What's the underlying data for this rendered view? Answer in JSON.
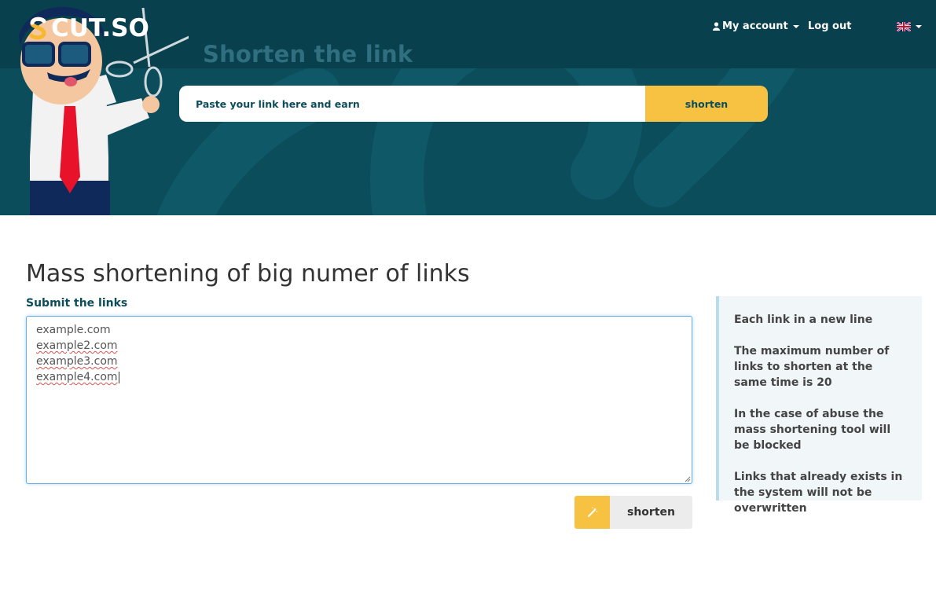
{
  "header": {
    "logo_text": "CUT.SO",
    "nav": {
      "my_account": "My account",
      "logout": "Log out",
      "language_icon": "uk-flag-icon"
    },
    "hero_title": "Shorten the link",
    "hero_input_placeholder": "Paste your link here and earn",
    "hero_button": "shorten"
  },
  "main": {
    "title": "Mass shortening of big numer of links",
    "submit_label": "Submit the links",
    "links": [
      "example.com",
      "example2.com",
      "example3.com",
      "example4.com"
    ],
    "submit_button": "shorten",
    "submit_icon": "magic-wand-icon"
  },
  "sidebar": {
    "notes": [
      "Each link in a new line",
      "The maximum number of links to shorten at the same time is 20",
      "In the case of abuse the mass shortening tool will be blocked",
      "Links that already exists in the system will not be overwritten"
    ]
  },
  "colors": {
    "hero_bg": "#0c4d5c",
    "topbar_bg": "#08404d",
    "accent_yellow": "#f7c242",
    "label_teal": "#0c4d5c"
  }
}
